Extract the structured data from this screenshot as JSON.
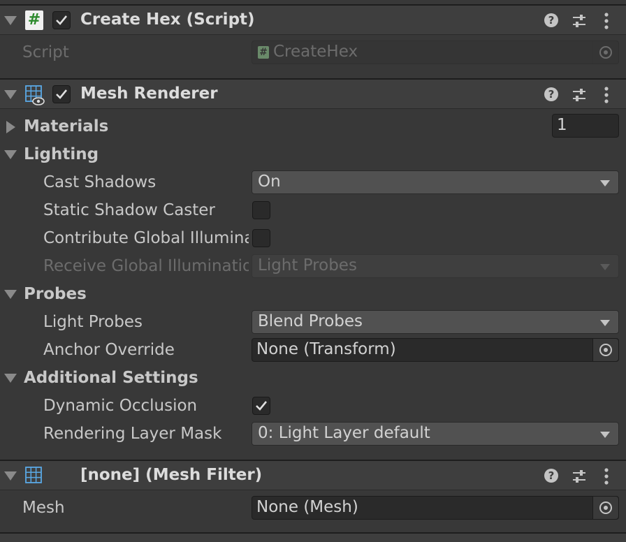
{
  "components": {
    "create_hex": {
      "title": "Create Hex (Script)",
      "script_label": "Script",
      "script_value": "CreateHex"
    },
    "mesh_renderer": {
      "title": "Mesh Renderer",
      "materials_label": "Materials",
      "materials_count": "1",
      "lighting_label": "Lighting",
      "cast_shadows_label": "Cast Shadows",
      "cast_shadows_value": "On",
      "static_shadow_label": "Static Shadow Caster",
      "contribute_gi_label": "Contribute Global Illuminat",
      "receive_gi_label": "Receive Global Illumination",
      "receive_gi_value": "Light Probes",
      "probes_label": "Probes",
      "light_probes_label": "Light Probes",
      "light_probes_value": "Blend Probes",
      "anchor_label": "Anchor Override",
      "anchor_value": "None (Transform)",
      "additional_label": "Additional Settings",
      "dynamic_occlusion_label": "Dynamic Occlusion",
      "rendering_mask_label": "Rendering Layer Mask",
      "rendering_mask_value": "0: Light Layer default"
    },
    "mesh_filter": {
      "title": "[none] (Mesh Filter)",
      "mesh_label": "Mesh",
      "mesh_value": "None (Mesh)"
    }
  },
  "icons": {
    "help": "help-icon",
    "presets": "presets-icon",
    "menu": "kebab-menu-icon",
    "script": "csharp-script-icon",
    "mesh_renderer": "mesh-renderer-icon",
    "mesh_filter": "mesh-filter-icon",
    "object_picker": "object-picker-icon"
  },
  "colors": {
    "background": "#383838",
    "header": "#3e3e3e",
    "field_dark": "#2a2a2a",
    "dropdown": "#515151",
    "script_green": "#3a8f3a",
    "mesh_icon_blue": "#5aa9e6"
  }
}
